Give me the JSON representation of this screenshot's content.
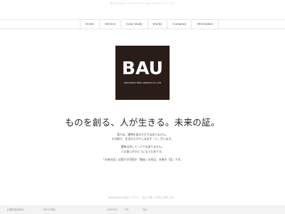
{
  "top_banner": "株式会社BAU・ARCHITECTURAL DESIGN CO.,LTD.",
  "nav": {
    "items": [
      "Home",
      "Service",
      "Case study",
      "Works",
      "Company",
      "Information"
    ]
  },
  "logo": {
    "word": "BAU",
    "subtitle": "ARCHITECTURAL DESIGN CO.,LTD"
  },
  "headline": "ものを創る、人が生きる。未来の証。",
  "body": {
    "paragraphs": [
      [
        "我々は、建物を造るだけではありません。",
        "もの創り、生活のカタチには必ず「人」がいます。"
      ],
      [
        "建物は決して一人ではありません。",
        "人の思いがひとつになった形です。"
      ],
      [
        "「未来の証」は我々が目指す「創造」の形は、未来の「証」です。"
      ]
    ]
  },
  "footer": {
    "note": "株式会社BAUの設計、デザイン・施工を通じて未来に貢献します。",
    "items": [
      "(c)株式会社BAU",
      "TOKYO本社",
      "CONTACT",
      "TEL",
      "FAX"
    ]
  },
  "colors": {
    "logo_bg": "#2a1d18",
    "footer_bg": "#f3f3f3"
  }
}
